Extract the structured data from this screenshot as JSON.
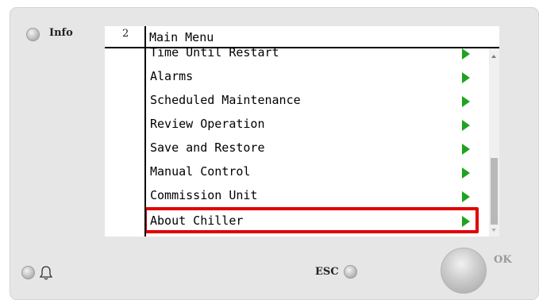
{
  "device": {
    "info_label": "Info",
    "esc_label": "ESC",
    "ok_label": "OK"
  },
  "screen": {
    "page_number": "2",
    "title": "Main Menu",
    "items": [
      {
        "label": "Time Until Restart"
      },
      {
        "label": "Alarms"
      },
      {
        "label": "Scheduled Maintenance"
      },
      {
        "label": "Review Operation"
      },
      {
        "label": "Save and Restore"
      },
      {
        "label": "Manual Control"
      },
      {
        "label": "Commission Unit"
      },
      {
        "label": "About Chiller"
      }
    ],
    "selected_index": 7
  },
  "icons": {
    "arrow": "right-triangle-arrow-icon",
    "bell": "bell-icon"
  },
  "colors": {
    "panel": "#e6e6e6",
    "arrow": "#1fa31f",
    "highlight": "#e10000"
  }
}
